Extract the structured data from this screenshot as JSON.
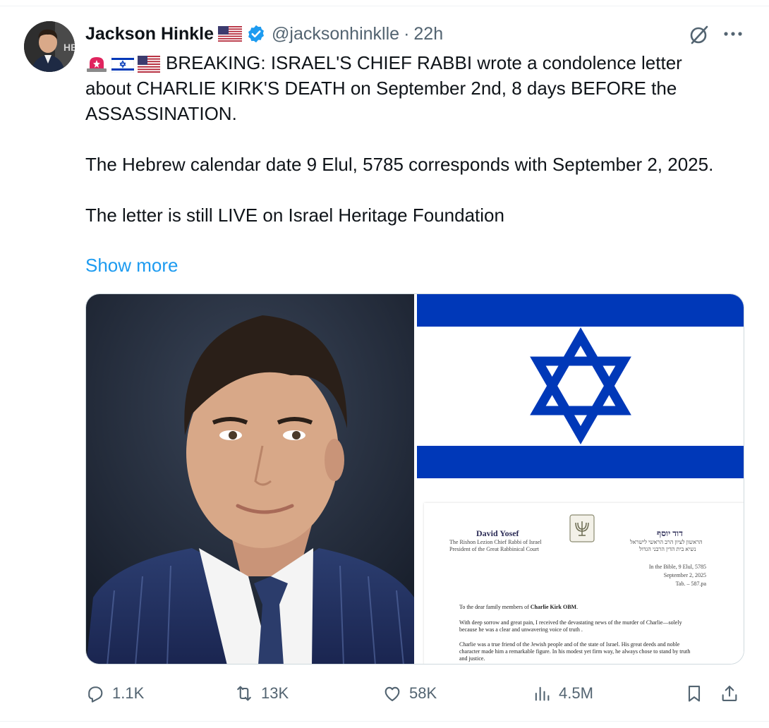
{
  "author": {
    "display_name": "Jackson Hinkle",
    "handle": "@jacksonhinklle",
    "separator": "·",
    "time": "22h",
    "avatar_overlay": "HB"
  },
  "tweet": {
    "line1": "BREAKING: ISRAEL'S CHIEF RABBI wrote a condolence letter about CHARLIE KIRK'S DEATH on September 2nd, 8 days BEFORE the ASSASSINATION.",
    "line2": "The Hebrew calendar date 9 Elul, 5785 corresponds with September 2, 2025.",
    "line3": "The letter is still LIVE on Israel Heritage Foundation",
    "show_more": "Show more"
  },
  "letter": {
    "name": "David Yosef",
    "subtitle1": "The Rishon Lezion Chief Rabbi of Israel",
    "subtitle2": "President of the Great Rabbinical Court",
    "hebrew_name": "דוד יוסף",
    "hebrew_sub1": "הראשון לציון הרב הראשי לישראל",
    "hebrew_sub2": "נשיא בית הדין הרבני הגדול",
    "date_line1": "In the Bible, 9 Elul, 5785",
    "date_line2": "September 2, 2025",
    "date_line3": "Tab. – 587.pa",
    "greeting_prefix": "To the dear family members of ",
    "greeting_name": "Charlie Kirk OBM",
    "greeting_suffix": ".",
    "para1": "With deep sorrow and great pain, I received the devastating news of the murder of Charlie—solely because he was a clear and unwavering voice of truth .",
    "para2": "Charlie was a true friend of the Jewish people and of the state of Israel. His great deeds and noble character made him a remarkable figure. In his modest yet firm way, he always chose to stand by truth and justice."
  },
  "actions": {
    "replies": "1.1K",
    "reposts": "13K",
    "likes": "58K",
    "views": "4.5M"
  },
  "colors": {
    "link": "#1d9bf0",
    "secondary_text": "#536471",
    "israel_blue": "#0038b8",
    "verified_blue": "#1d9bf0"
  },
  "icons": [
    "grok-icon",
    "more-icon",
    "verified-icon",
    "us-flag-icon",
    "siren-icon",
    "israel-flag-icon",
    "reply-icon",
    "retweet-icon",
    "like-icon",
    "views-icon",
    "bookmark-icon",
    "share-icon"
  ]
}
